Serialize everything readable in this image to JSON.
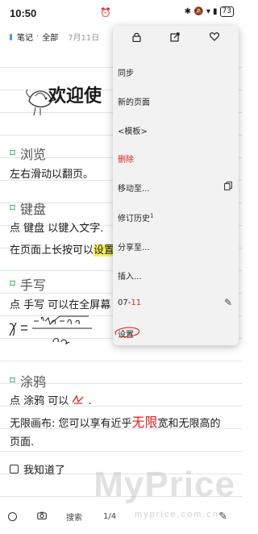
{
  "status": {
    "time": "10:50",
    "battery": "73",
    "mid_icon": "⏰",
    "icons": "✱ 🔕 ▾ ▮"
  },
  "header": {
    "path_1": "笔记",
    "separator": "·",
    "path_2": "全部",
    "date": "7月11日"
  },
  "note": {
    "welcome": "欢迎使",
    "sections": [
      {
        "title": "浏览",
        "lines": [
          "左右滑动以翻页。"
        ]
      },
      {
        "title": "键盘",
        "line1": "点 键盘 以键入文字.",
        "line2_pre": "在页面上长按可以",
        "line2_hl": "设置"
      },
      {
        "title": "手写",
        "lines": [
          "点 手写 可以在全屏幕"
        ]
      },
      {
        "title": "涂鸦",
        "line1": "点 涂鸦 可以",
        "line1_post": ".",
        "line2_pre": "无限画布: 您可以享有近乎",
        "line2_red": "无限",
        "line2_post": "宽和无限高的",
        "line3": "页面."
      }
    ],
    "checkbox_label": "我知道了"
  },
  "toolbar": {
    "search": "搜索",
    "page": "1/4"
  },
  "watermark": {
    "main": "MyPrice",
    "sub": "myprice.com.cn"
  },
  "menu": {
    "top_icons": [
      "lock-icon",
      "external-edit-icon",
      "heart-icon"
    ],
    "items": {
      "sync": "同步",
      "new_page": "新的页面",
      "template": "<模板>",
      "delete": "删除",
      "move_to": "移动至...",
      "history": "修订历史",
      "history_sup": "1",
      "share_to": "分享至...",
      "insert": "插入...",
      "date_pre": "07-",
      "date_red": "11",
      "settings": "设置"
    }
  },
  "colors": {
    "accent_green": "#2ca44c",
    "danger_red": "#e02020",
    "highlight": "#f8f25a"
  }
}
